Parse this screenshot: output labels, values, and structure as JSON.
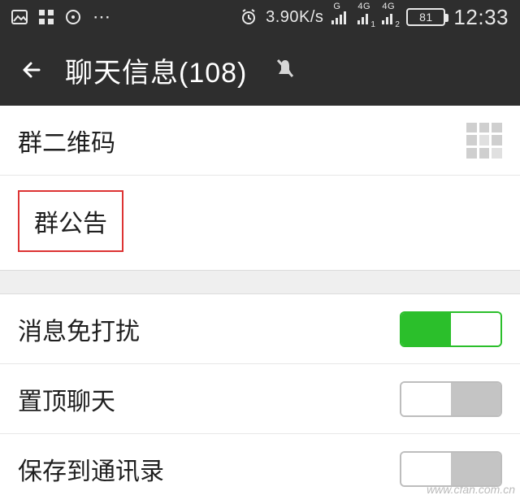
{
  "status": {
    "speed": "3.90K/s",
    "net_g": "G",
    "net_4g_1": "4G",
    "net_4g_2": "4G",
    "sig_sub_1": "1",
    "sig_sub_2": "2",
    "battery": "81",
    "time": "12:33"
  },
  "header": {
    "title": "聊天信息(108)"
  },
  "rows": {
    "qrcode": "群二维码",
    "announcement": "群公告",
    "mute": "消息免打扰",
    "pin": "置顶聊天",
    "save_contacts": "保存到通讯录"
  },
  "toggles": {
    "mute": true,
    "pin": false,
    "save_contacts": false
  },
  "watermark": "www.cfan.com.cn"
}
